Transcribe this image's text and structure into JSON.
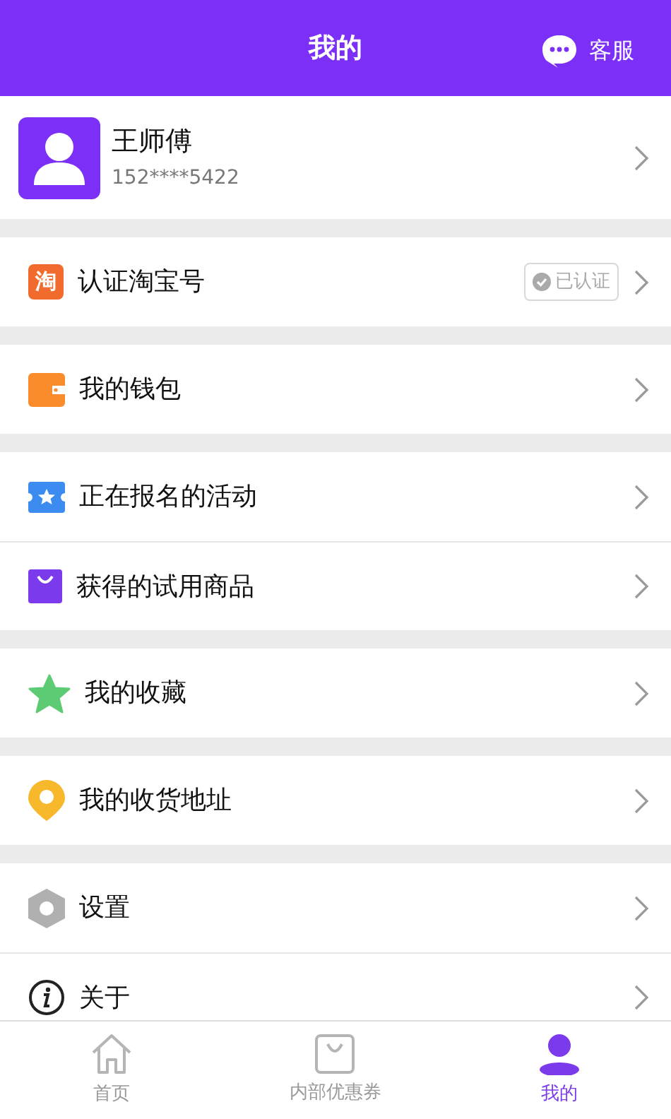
{
  "header": {
    "title": "我的",
    "service": "客服"
  },
  "profile": {
    "name": "王师傅",
    "phone": "152****5422"
  },
  "groups": [
    {
      "items": [
        {
          "label": "认证淘宝号",
          "kind": "taobao",
          "icon_text": "淘",
          "badge": "已认证"
        }
      ]
    },
    {
      "items": [
        {
          "label": "我的钱包",
          "kind": "wallet"
        }
      ]
    },
    {
      "items": [
        {
          "label": "正在报名的活动",
          "kind": "ticket"
        },
        {
          "label": "获得的试用商品",
          "kind": "bag"
        }
      ]
    },
    {
      "items": [
        {
          "label": "我的收藏",
          "kind": "star"
        }
      ]
    },
    {
      "items": [
        {
          "label": "我的收货地址",
          "kind": "pin"
        }
      ]
    },
    {
      "items": [
        {
          "label": "设置",
          "kind": "hexagon"
        },
        {
          "label": "关于",
          "kind": "info"
        }
      ]
    }
  ],
  "tabs": [
    {
      "label": "首页",
      "kind": "home",
      "selected": false
    },
    {
      "label": "内部优惠券",
      "kind": "bag",
      "selected": false
    },
    {
      "label": "我的",
      "kind": "person",
      "selected": true
    }
  ]
}
